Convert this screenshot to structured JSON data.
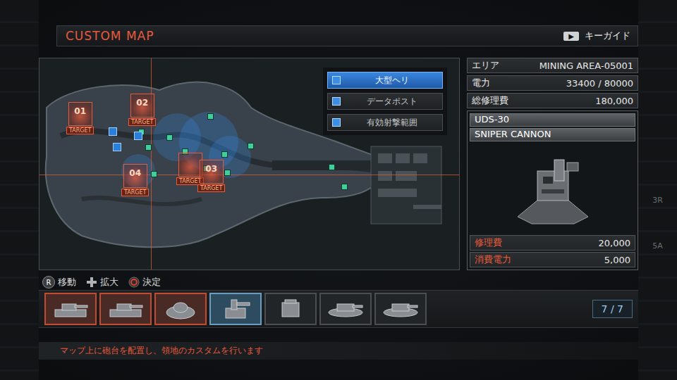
{
  "header": {
    "title": "CUSTOM MAP",
    "key_guide": {
      "key": "▶",
      "label": "キーガイド"
    }
  },
  "map": {
    "legend": [
      {
        "label": "大型ヘリ",
        "selected": true
      },
      {
        "label": "データポスト",
        "selected": false
      },
      {
        "label": "有効射撃範囲",
        "selected": false
      }
    ],
    "targets": [
      {
        "number": "01",
        "label": "TARGET"
      },
      {
        "number": "02",
        "label": "TARGET"
      },
      {
        "number": "04",
        "label": "TARGET"
      },
      {
        "label": "TARGET"
      },
      {
        "number": "03",
        "label": "TARGET"
      }
    ]
  },
  "info": {
    "rows": [
      {
        "label": "エリア",
        "value": "MINING AREA-05001"
      },
      {
        "label": "電力",
        "value": "33400 / 80000"
      },
      {
        "label": "総修理費",
        "value": "180,000"
      }
    ],
    "unit": {
      "model": "UDS-30",
      "type": "SNIPER CANNON",
      "stats": [
        {
          "label": "修理費",
          "value": "20,000"
        },
        {
          "label": "消費電力",
          "value": "5,000"
        }
      ]
    }
  },
  "controls": [
    {
      "kind": "stick",
      "key": "R",
      "label": "移動"
    },
    {
      "kind": "dpad",
      "label": "拡大"
    },
    {
      "kind": "circle",
      "label": "決定"
    }
  ],
  "thumbnails": [
    {
      "kind": "tank",
      "placed": true,
      "selected": false
    },
    {
      "kind": "tank",
      "placed": true,
      "selected": false
    },
    {
      "kind": "dome",
      "placed": true,
      "selected": false
    },
    {
      "kind": "cannon",
      "placed": false,
      "selected": true
    },
    {
      "kind": "turret",
      "placed": false,
      "selected": false
    },
    {
      "kind": "hover",
      "placed": false,
      "selected": false
    },
    {
      "kind": "hover",
      "placed": false,
      "selected": false
    }
  ],
  "counter": "7 / 7",
  "footer": "マップ上に砲台を配置し、領地のカスタムを行います",
  "side_marks": [
    "3R",
    "5A"
  ]
}
